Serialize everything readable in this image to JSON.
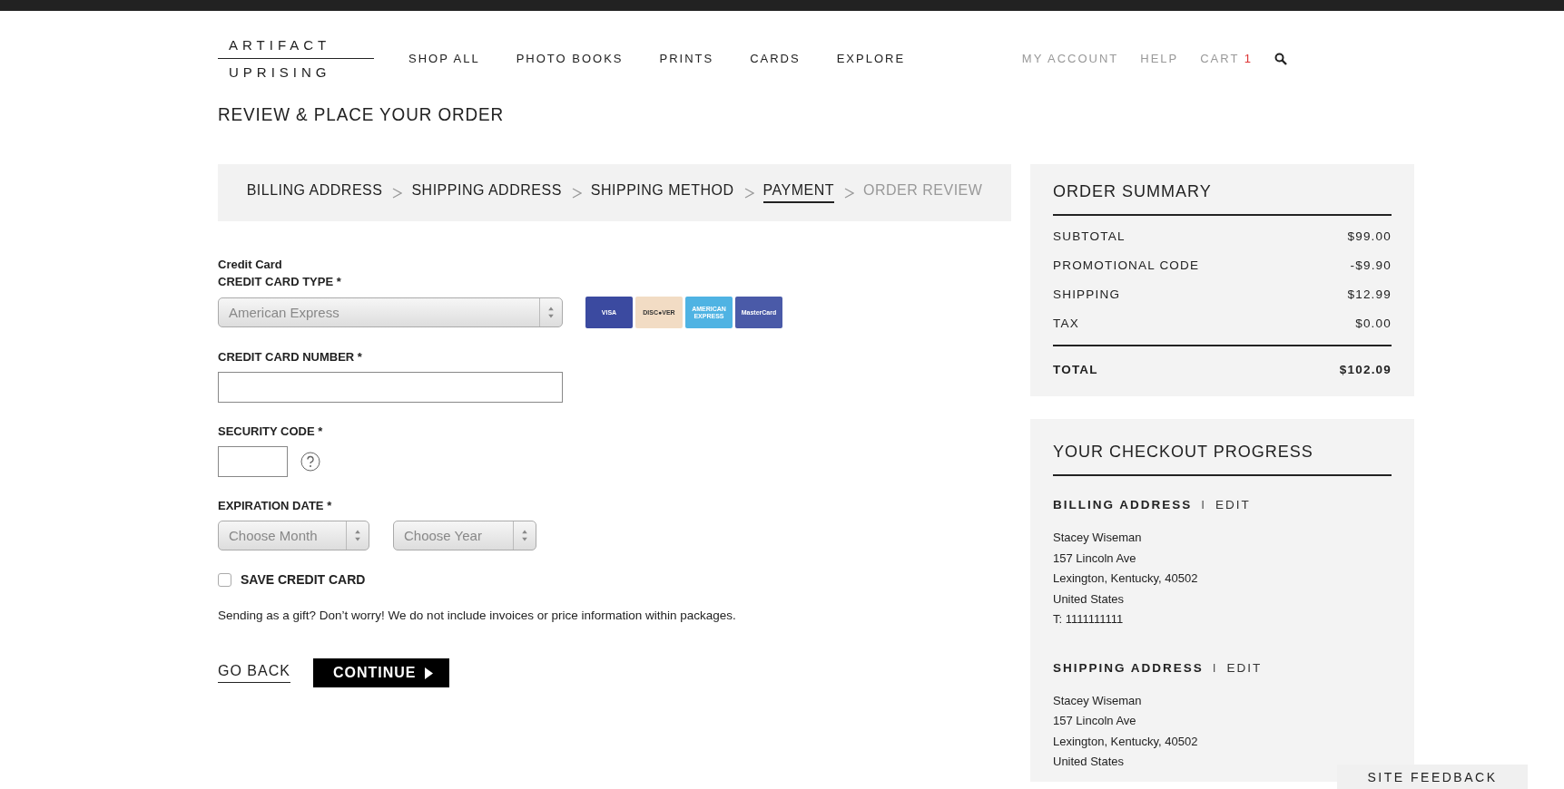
{
  "header": {
    "logo": {
      "line_1": "ARTIFACT",
      "line_2": "UPRISING"
    },
    "nav": [
      "SHOP ALL",
      "PHOTO BOOKS",
      "PRINTS",
      "CARDS",
      "EXPLORE"
    ],
    "account_links": [
      "MY ACCOUNT",
      "HELP"
    ],
    "cart": {
      "label": "CART",
      "count": "1"
    }
  },
  "page_title": "REVIEW & PLACE YOUR ORDER",
  "breadcrumb": [
    {
      "label": "BILLING ADDRESS",
      "selected": false,
      "disabled": false
    },
    {
      "label": "SHIPPING ADDRESS",
      "selected": false,
      "disabled": false
    },
    {
      "label": "SHIPPING METHOD",
      "selected": false,
      "disabled": false
    },
    {
      "label": "PAYMENT",
      "selected": true,
      "disabled": false
    },
    {
      "label": "ORDER REVIEW",
      "selected": false,
      "disabled": true
    }
  ],
  "payment": {
    "section_title": "Credit Card",
    "card_type": {
      "label": "CREDIT CARD TYPE *",
      "value": "American Express"
    },
    "card_logos": [
      {
        "label": "VISA",
        "color": "#3b4aa0"
      },
      {
        "label": "DISC●VER",
        "color": "#f2dcc4"
      },
      {
        "label": "AMERICAN EXPRESS",
        "color": "#4fb3e3"
      },
      {
        "label": "MasterCard",
        "color": "#4a5aa8"
      }
    ],
    "card_number": {
      "label": "CREDIT CARD NUMBER *"
    },
    "security_code": {
      "label": "SECURITY CODE *"
    },
    "expiration": {
      "label": "EXPIRATION DATE *",
      "month_placeholder": "Choose Month",
      "year_placeholder": "Choose Year"
    },
    "save_card": {
      "label": "SAVE CREDIT CARD",
      "checked": false
    },
    "note": "Sending as a gift? Don’t worry! We do not include invoices or price information within packages.",
    "back_link": "GO BACK",
    "continue_button": "CONTINUE"
  },
  "order_summary": {
    "title": "ORDER SUMMARY",
    "rows": [
      {
        "label": "SUBTOTAL",
        "value": "$99.00"
      },
      {
        "label": "PROMOTIONAL CODE",
        "value": "-$9.90"
      },
      {
        "label": "SHIPPING",
        "value": "$12.99"
      },
      {
        "label": "TAX",
        "value": "$0.00"
      }
    ],
    "total": {
      "label": "TOTAL",
      "value": "$102.09"
    }
  },
  "checkout_progress": {
    "title": "YOUR CHECKOUT PROGRESS",
    "sections": [
      {
        "heading": "BILLING ADDRESS",
        "separator": "I",
        "action": "EDIT",
        "lines": [
          "Stacey Wiseman",
          "157 Lincoln Ave",
          "Lexington, Kentucky, 40502",
          "United States",
          "T: 1111111111"
        ]
      },
      {
        "heading": "SHIPPING ADDRESS",
        "separator": "I",
        "action": "EDIT",
        "lines": [
          "Stacey Wiseman",
          "157 Lincoln Ave",
          "Lexington, Kentucky, 40502",
          "United States"
        ]
      }
    ]
  },
  "site_feedback": "SITE FEEDBACK"
}
